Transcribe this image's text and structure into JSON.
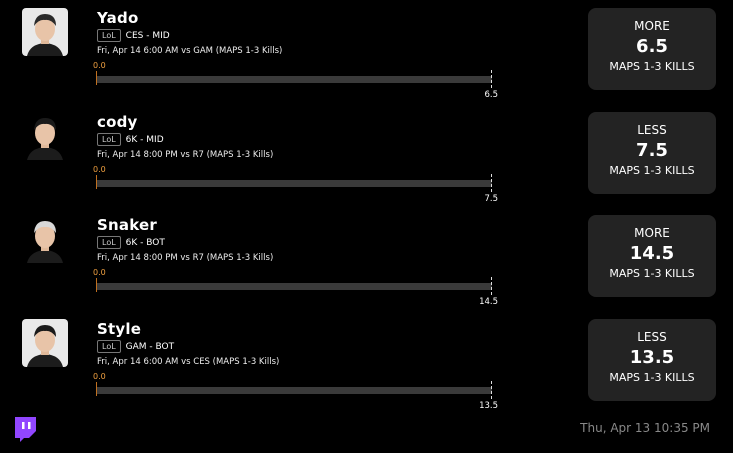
{
  "players": [
    {
      "name": "Yado",
      "game_badge": "LoL",
      "team_pos": "CES - MID",
      "game_info": "Fri, Apr 14 6:00 AM  vs GAM (MAPS 1-3 Kills)",
      "current": "0.0",
      "progress": 0,
      "line": "6.5",
      "pick": "MORE",
      "stat": "MAPS 1-3 KILLS",
      "avatar_bg": "#e9e9e9",
      "hair_color": "#2a2a2a"
    },
    {
      "name": "cody",
      "game_badge": "LoL",
      "team_pos": "6K - MID",
      "game_info": "Fri, Apr 14 8:00 PM  vs R7 (MAPS 1-3 Kills)",
      "current": "0.0",
      "progress": 0,
      "line": "7.5",
      "pick": "LESS",
      "stat": "MAPS 1-3 KILLS",
      "avatar_bg": "#000000",
      "hair_color": "#1a1a1a"
    },
    {
      "name": "Snaker",
      "game_badge": "LoL",
      "team_pos": "6K - BOT",
      "game_info": "Fri, Apr 14 8:00 PM  vs R7 (MAPS 1-3 Kills)",
      "current": "0.0",
      "progress": 0,
      "line": "14.5",
      "pick": "MORE",
      "stat": "MAPS 1-3 KILLS",
      "avatar_bg": "#000000",
      "hair_color": "#d8d8d8"
    },
    {
      "name": "Style",
      "game_badge": "LoL",
      "team_pos": "GAM - BOT",
      "game_info": "Fri, Apr 14 6:00 AM  vs CES (MAPS 1-3 Kills)",
      "current": "0.0",
      "progress": 0,
      "line": "13.5",
      "pick": "LESS",
      "stat": "MAPS 1-3 KILLS",
      "avatar_bg": "#e9e9e9",
      "hair_color": "#1a1a1a"
    }
  ],
  "footer": {
    "logo_icon": "twitch-icon",
    "logo_color": "#9146ff",
    "timestamp": "Thu, Apr 13 10:35 PM"
  }
}
